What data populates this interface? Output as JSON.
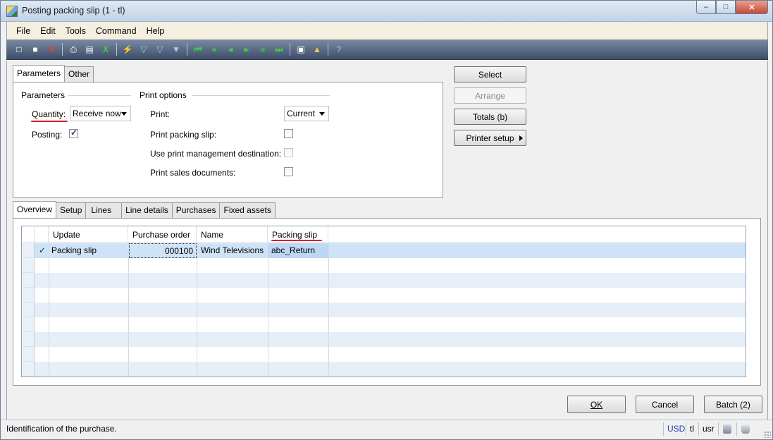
{
  "window": {
    "title": "Posting packing slip (1 - tl)",
    "controls": {
      "minimize": "–",
      "maximize": "□",
      "close": "✕"
    }
  },
  "menu": [
    "File",
    "Edit",
    "Tools",
    "Command",
    "Help"
  ],
  "toolbar": [
    {
      "name": "new-record-icon",
      "glyph": "□"
    },
    {
      "name": "save-icon",
      "glyph": "■"
    },
    {
      "name": "delete-icon",
      "glyph": "✕"
    },
    {
      "name": "print-icon",
      "glyph": "⎙"
    },
    {
      "name": "print-preview-icon",
      "glyph": "▤"
    },
    {
      "name": "export-excel-icon",
      "glyph": "X"
    },
    {
      "name": "filter-by-selection-icon",
      "glyph": "⚡"
    },
    {
      "name": "filter-by-grid-icon",
      "glyph": "▽"
    },
    {
      "name": "advanced-filter-icon",
      "glyph": "▽"
    },
    {
      "name": "remove-filter-icon",
      "glyph": "▼"
    },
    {
      "name": "first-record-icon",
      "glyph": "⏮"
    },
    {
      "name": "previous-page-icon",
      "glyph": "«"
    },
    {
      "name": "previous-record-icon",
      "glyph": "◂"
    },
    {
      "name": "next-record-icon",
      "glyph": "▸"
    },
    {
      "name": "next-page-icon",
      "glyph": "»"
    },
    {
      "name": "last-record-icon",
      "glyph": "⏭"
    },
    {
      "name": "document-handling-icon",
      "glyph": "▣"
    },
    {
      "name": "alert-bell-icon",
      "glyph": "▲"
    },
    {
      "name": "help-icon",
      "glyph": "?"
    }
  ],
  "top_tabs": [
    "Parameters",
    "Other"
  ],
  "parameters": {
    "section_title": "Parameters",
    "quantity_label": "Quantity:",
    "quantity_value": "Receive now",
    "posting_label": "Posting:",
    "posting_checked": true
  },
  "print_options": {
    "section_title": "Print options",
    "print_label": "Print:",
    "print_value": "Current",
    "print_packing_slip_label": "Print packing slip:",
    "print_packing_slip_checked": false,
    "use_print_mgmt_label": "Use print management destination:",
    "use_print_mgmt_checked": false,
    "print_sales_docs_label": "Print sales documents:",
    "print_sales_docs_checked": false
  },
  "side_buttons": {
    "select": "Select",
    "arrange": "Arrange",
    "totals": "Totals (b)",
    "printer_setup": "Printer setup"
  },
  "bottom_tabs": [
    "Overview",
    "Setup",
    "Lines",
    "Line details",
    "Purchases",
    "Fixed assets"
  ],
  "grid": {
    "columns": [
      "Update",
      "Purchase order",
      "Name",
      "Packing slip"
    ],
    "rows": [
      {
        "marker": "✓",
        "update": "Packing slip",
        "purchase_order": "000100",
        "name": "Wind Televisions",
        "packing_slip": "abc_Return"
      }
    ]
  },
  "dialog_buttons": {
    "ok": "OK",
    "cancel": "Cancel",
    "batch": "Batch (2)"
  },
  "status": {
    "message": "Identification of the purchase.",
    "currency": "USD",
    "company": "tl",
    "layer": "usr"
  }
}
